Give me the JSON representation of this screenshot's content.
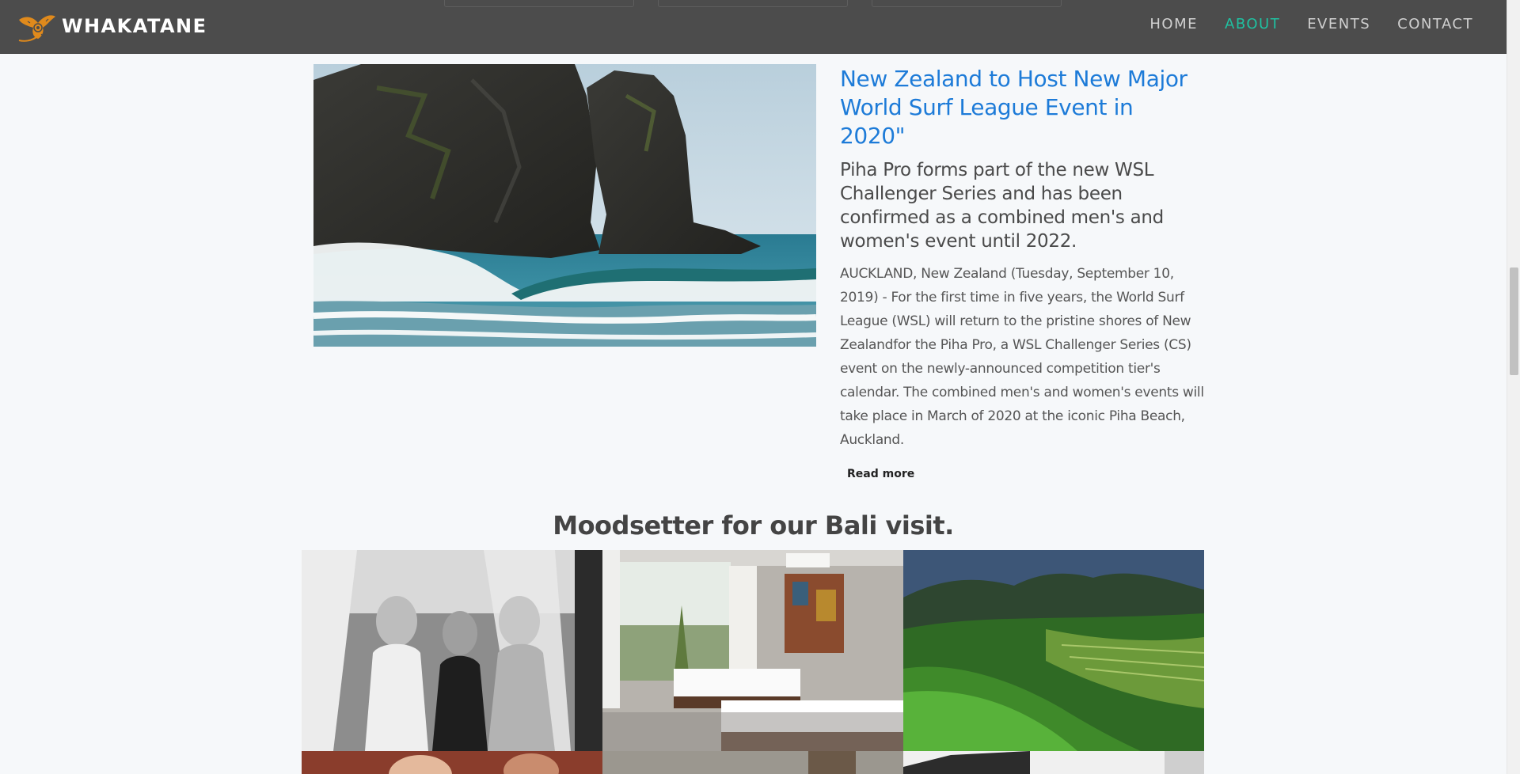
{
  "navbar": {
    "brand": "WHAKATANE",
    "logo_icon": "stingray-logo-icon",
    "links": [
      {
        "label": "HOME",
        "active": false
      },
      {
        "label": "ABOUT",
        "active": true
      },
      {
        "label": "EVENTS",
        "active": false
      },
      {
        "label": "CONTACT",
        "active": false
      }
    ]
  },
  "article": {
    "image": "coastal-cliff-waves-photo",
    "title": "New Zealand to Host New Major World Surf League Event in 2020\"",
    "subtitle": "Piha Pro forms part of the new WSL Challenger Series and has been confirmed as a combined men's and women's event until 2022.",
    "body": "AUCKLAND, New Zealand (Tuesday, September 10, 2019) - For the first time in five years, the World Surf League (WSL) will return to the pristine shores of New Zealandfor the Piha Pro, a WSL Challenger Series (CS) event on the newly-announced competition tier's calendar. The combined men's and women's events will take place in March of 2020 at the iconic Piha Beach, Auckland.",
    "read_more": "Read more"
  },
  "gallery": {
    "title": "Moodsetter for our Bali visit.",
    "photos": [
      "women-friends-photo",
      "bedroom-photo",
      "rice-terrace-photo",
      "people-photo",
      "interior-photo",
      "building-photo"
    ]
  },
  "colors": {
    "navbar_bg": "#4c4c4c",
    "nav_active": "#1fc1a1",
    "title_link": "#1d7bd8",
    "page_bg": "#f6f8fa"
  }
}
